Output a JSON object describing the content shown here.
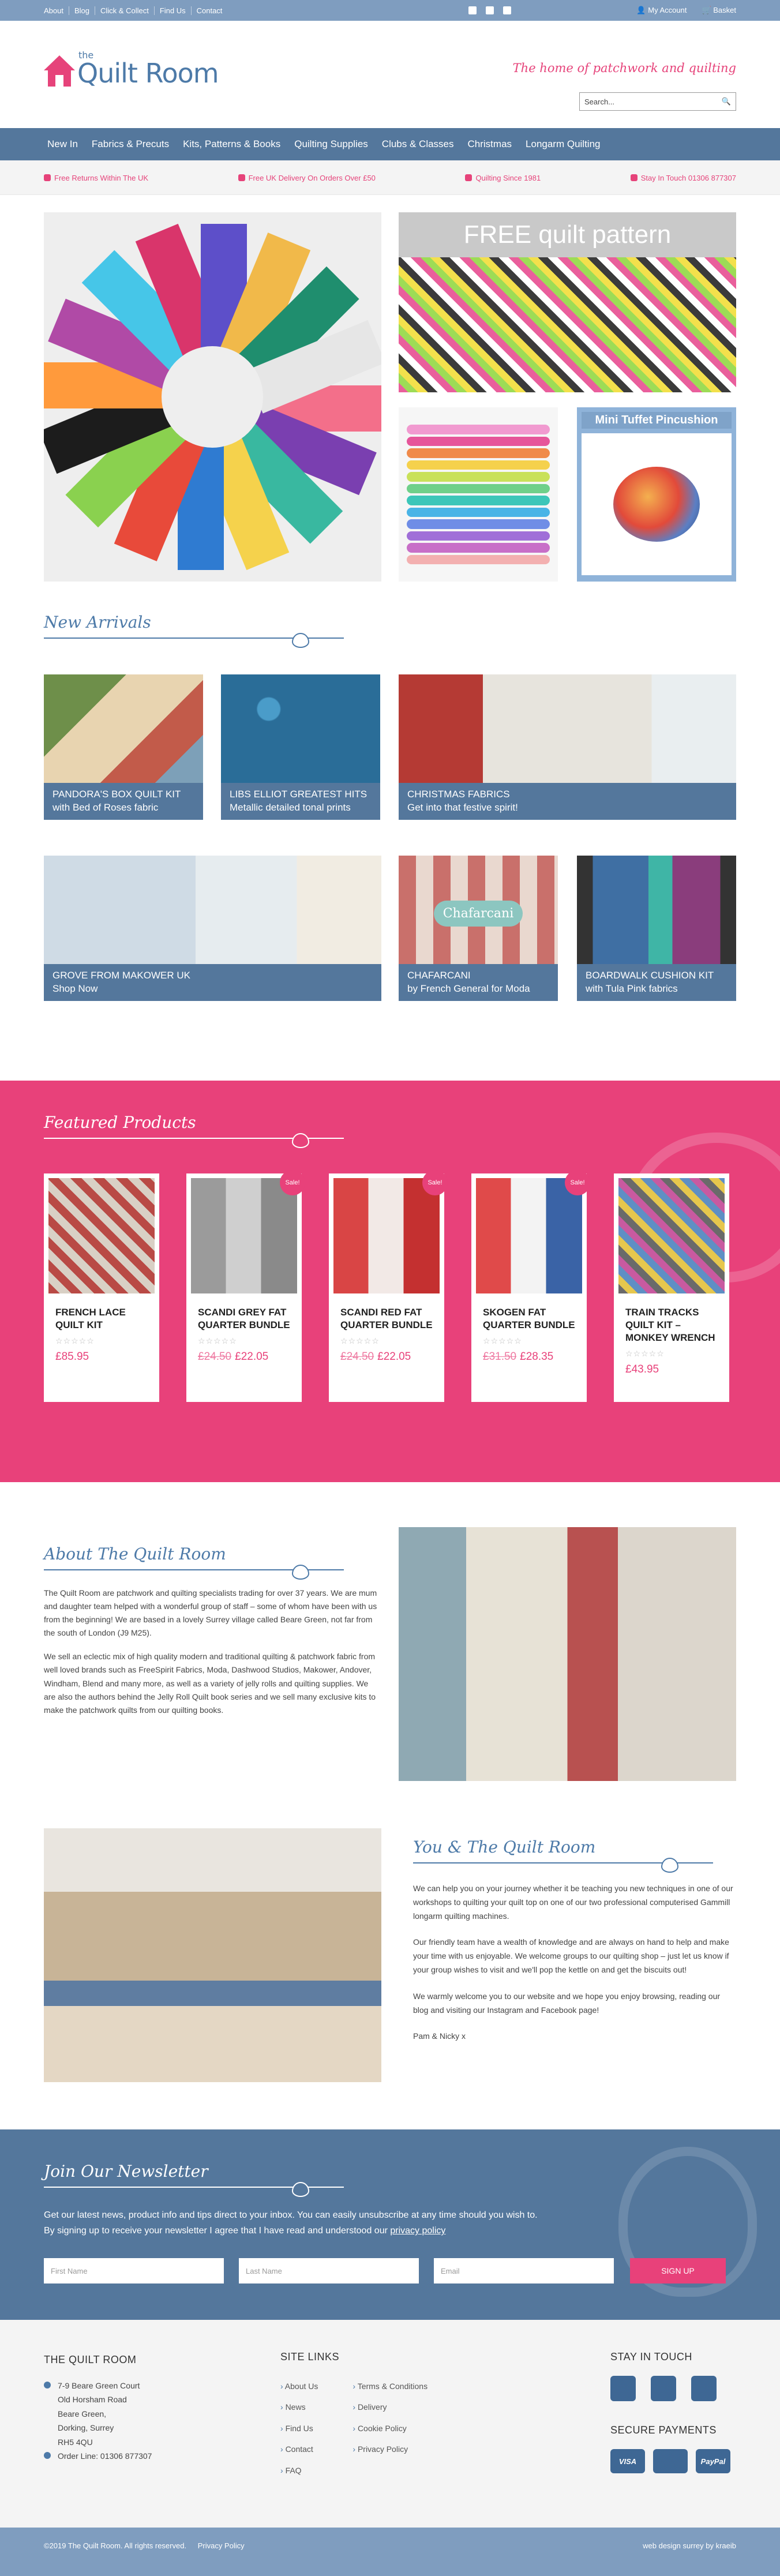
{
  "topbar": {
    "links": [
      "About",
      "Blog",
      "Click & Collect",
      "Find Us",
      "Contact"
    ],
    "account": "My Account",
    "basket": "Basket"
  },
  "header": {
    "logo_the": "the",
    "logo_name": "Quilt Room",
    "tagline": "The home of patchwork and quilting",
    "search_placeholder": "Search..."
  },
  "nav": [
    "New In",
    "Fabrics & Precuts",
    "Kits, Patterns & Books",
    "Quilting Supplies",
    "Clubs & Classes",
    "Christmas",
    "Longarm Quilting"
  ],
  "usp": [
    "Free Returns Within The UK",
    "Free UK Delivery On Orders Over £50",
    "Quilting Since 1981",
    "Stay In Touch 01306 877307"
  ],
  "hero": {
    "free_title": "FREE quilt pattern",
    "pin_title": "Mini Tuffet Pincushion"
  },
  "arrivals": {
    "heading": "New Arrivals",
    "tiles": [
      {
        "title": "PANDORA'S BOX QUILT KIT",
        "sub": "with Bed of Roses fabric"
      },
      {
        "title": "LIBS ELLIOT GREATEST HITS",
        "sub": "Metallic detailed tonal prints"
      },
      {
        "title": "CHRISTMAS FABRICS",
        "sub": "Get into that festive spirit!"
      },
      {
        "title": "GROVE FROM MAKOWER UK",
        "sub": "Shop Now"
      },
      {
        "title": "CHAFARCANI",
        "sub": "by French General for Moda"
      },
      {
        "title": "BOARDWALK CUSHION KIT",
        "sub": "with Tula Pink fabrics"
      }
    ],
    "chafarcani_label": "Chafarcani"
  },
  "featured": {
    "heading": "Featured Products",
    "sale_label": "Sale!",
    "products": [
      {
        "name": "FRENCH LACE QUILT KIT",
        "old": "",
        "price": "£85.95"
      },
      {
        "name": "SCANDI GREY FAT QUARTER BUNDLE",
        "old": "£24.50",
        "price": "£22.05"
      },
      {
        "name": "SCANDI RED FAT QUARTER BUNDLE",
        "old": "£24.50",
        "price": "£22.05"
      },
      {
        "name": "SKOGEN FAT QUARTER BUNDLE",
        "old": "£31.50",
        "price": "£28.35"
      },
      {
        "name": "TRAIN TRACKS QUILT KIT – MONKEY WRENCH",
        "old": "",
        "price": "£43.95"
      }
    ]
  },
  "about": {
    "heading": "About The Quilt Room",
    "p1": "The Quilt Room are patchwork and quilting specialists trading for over 37 years. We are mum and daughter team helped with a wonderful group of staff – some of whom have been with us from the beginning! We are based in a lovely Surrey village called Beare Green, not far from the south of London (J9 M25).",
    "p2": "We sell an eclectic mix of high quality modern and traditional quilting & patchwork fabric from well loved brands such as FreeSpirit Fabrics, Moda, Dashwood Studios, Makower, Andover, Windham, Blend and many more, as well as a variety of jelly rolls and quilting supplies. We are also the authors behind the Jelly Roll Quilt book series and we sell many exclusive kits to make the patchwork quilts from our quilting books."
  },
  "youme": {
    "heading": "You & The Quilt Room",
    "p1": "We can help you on your journey whether it be teaching you new techniques in one of our workshops to quilting your quilt top on one of our two professional computerised Gammill longarm quilting machines.",
    "p2": "Our friendly team have a wealth of knowledge and are always on hand to help and make your time with us enjoyable. We welcome groups to our quilting shop – just let us know if your group wishes to visit and we'll pop the kettle on and get the biscuits out!",
    "p3": "We warmly welcome you to our website and we hope you enjoy browsing, reading our blog and visiting our Instagram and Facebook page!",
    "sign": "Pam & Nicky x"
  },
  "newsletter": {
    "heading": "Join Our Newsletter",
    "line1": "Get our latest news, product info and tips direct to your inbox. You can easily unsubscribe at any time should you wish to.",
    "line2": "By signing up to receive your newsletter I agree that I have read and understood our",
    "privacy": "privacy policy",
    "first": "First Name",
    "last": "Last Name",
    "email": "Email",
    "button": "SIGN UP"
  },
  "footer": {
    "col1_title": "THE QUILT ROOM",
    "address": [
      "7-9 Beare Green Court",
      "Old Horsham Road",
      "Beare Green,",
      "Dorking, Surrey",
      "RH5 4QU"
    ],
    "phone": "Order Line: 01306 877307",
    "col2_title": "SITE LINKS",
    "links_a": [
      "About Us",
      "News",
      "Find Us",
      "Contact",
      "FAQ"
    ],
    "links_b": [
      "Terms & Conditions",
      "Delivery",
      "Cookie Policy",
      "Privacy Policy"
    ],
    "col3_title": "STAY IN TOUCH",
    "pay_title": "SECURE PAYMENTS",
    "pay": [
      "VISA",
      "",
      "PayPal"
    ]
  },
  "copyright": {
    "left": "©2019 The Quilt Room. All rights reserved.",
    "privacy": "Privacy Policy",
    "right": "web design surrey by kraeib"
  }
}
